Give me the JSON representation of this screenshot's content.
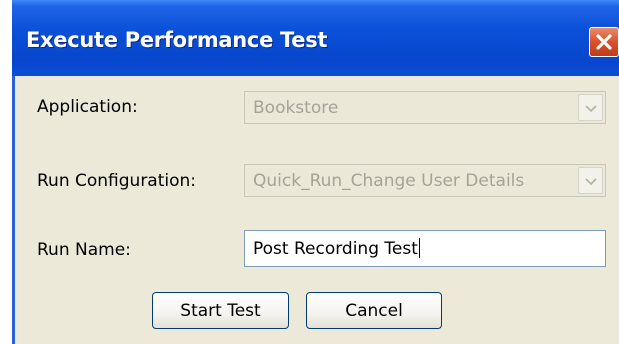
{
  "dialog": {
    "title": "Execute Performance Test",
    "close_icon": "close-icon"
  },
  "form": {
    "application": {
      "label": "Application:",
      "value": "Bookstore",
      "disabled": true
    },
    "run_configuration": {
      "label": "Run Configuration:",
      "value": "Quick_Run_Change User Details",
      "disabled": true
    },
    "run_name": {
      "label": "Run Name:",
      "value": "Post Recording Test"
    }
  },
  "buttons": {
    "start_test": "Start Test",
    "cancel": "Cancel"
  },
  "colors": {
    "title_bar": "#0a50d8",
    "dialog_bg": "#ece9d8",
    "close_button": "#d9512c",
    "disabled_text": "#a6a296"
  }
}
